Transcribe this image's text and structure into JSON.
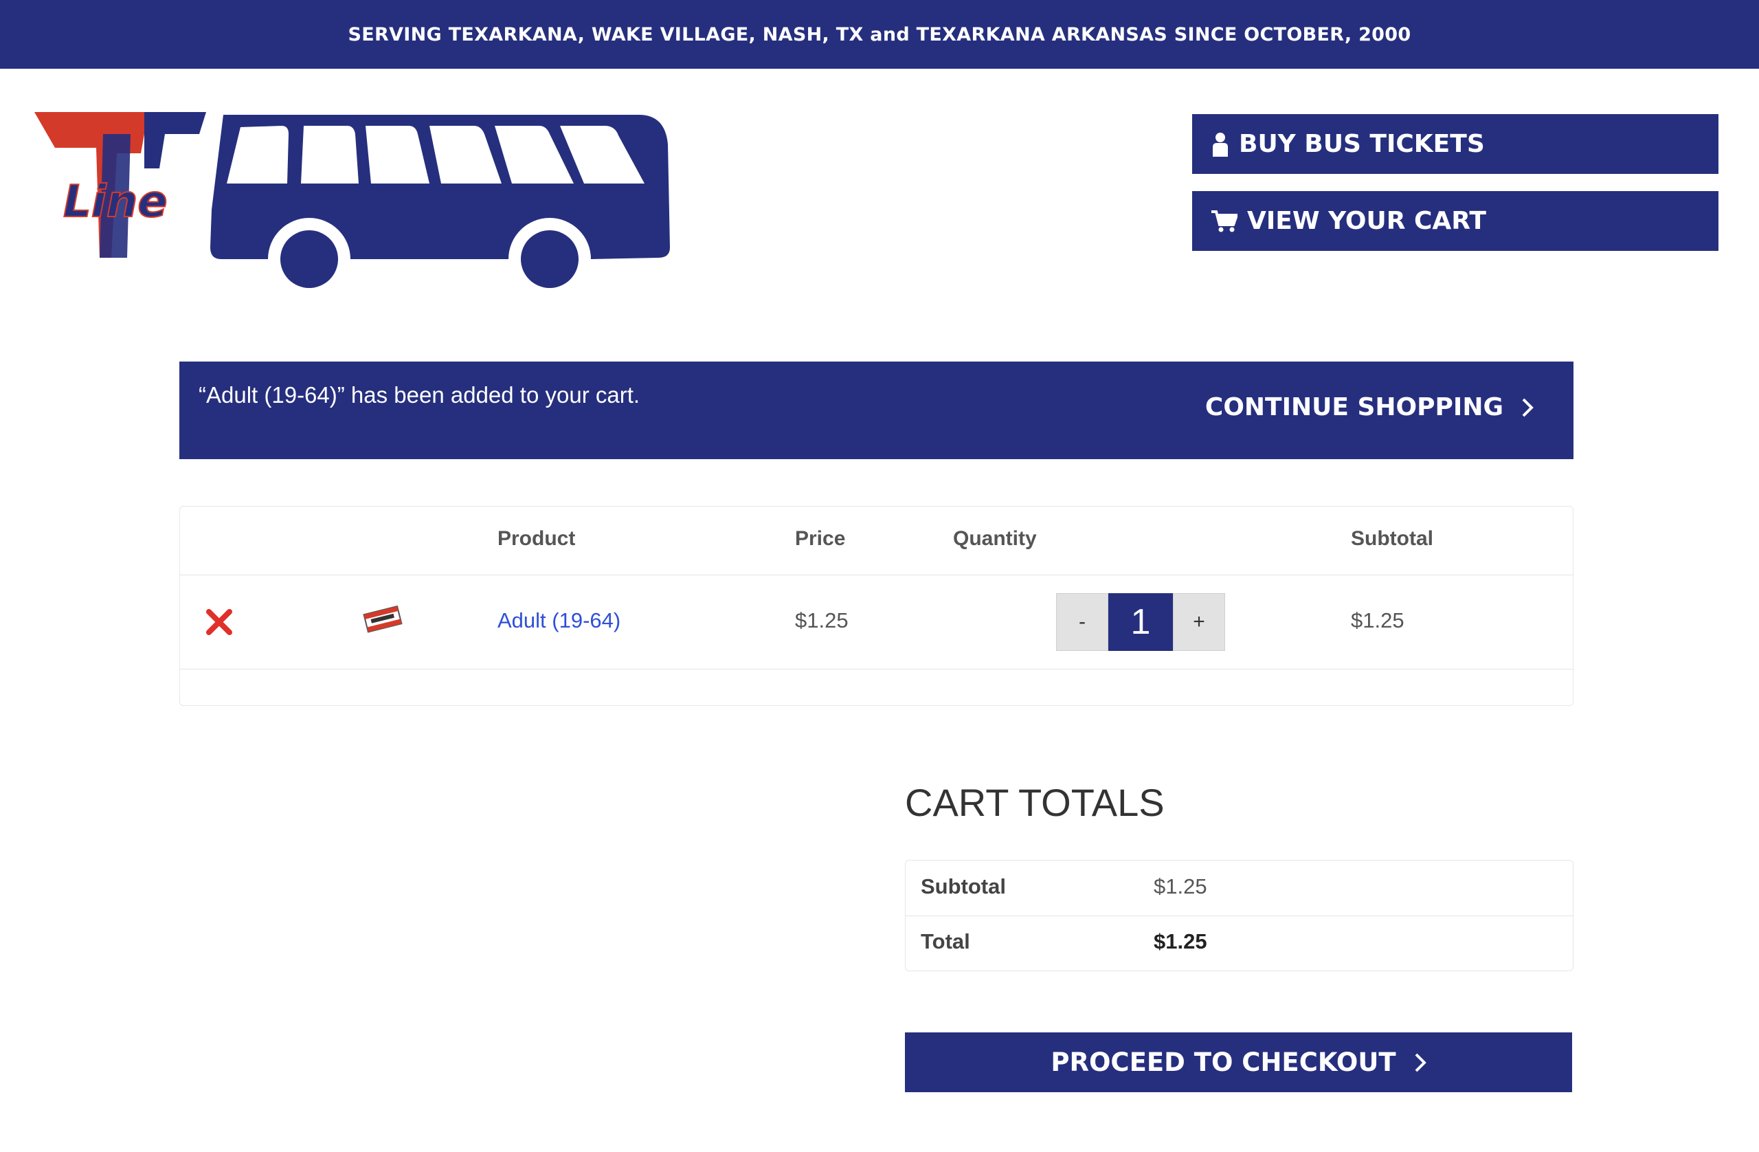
{
  "banner": {
    "text": "SERVING TEXARKANA, WAKE VILLAGE, NASH, TX and TEXARKANA ARKANSAS SINCE OCTOBER, 2000"
  },
  "logo": {
    "wordmark": "Line"
  },
  "header": {
    "buy_tickets_label": "BUY BUS TICKETS",
    "view_cart_label": "VIEW YOUR CART"
  },
  "notice": {
    "message": "“Adult (19-64)” has been added to your cart.",
    "continue_label": "CONTINUE SHOPPING"
  },
  "cart": {
    "columns": {
      "product": "Product",
      "price": "Price",
      "quantity": "Quantity",
      "subtotal": "Subtotal"
    },
    "items": [
      {
        "product": "Adult (19-64)",
        "price": "$1.25",
        "quantity": "1",
        "subtotal": "$1.25",
        "minus": "-",
        "plus": "+"
      }
    ]
  },
  "totals": {
    "title": "CART TOTALS",
    "subtotal_label": "Subtotal",
    "subtotal_value": "$1.25",
    "total_label": "Total",
    "total_value": "$1.25"
  },
  "checkout": {
    "label": "PROCEED TO CHECKOUT"
  },
  "colors": {
    "brand": "#262f7e",
    "logo_red": "#d43a2a",
    "link": "#2f4fd8",
    "remove": "#e0302a"
  },
  "icons": [
    "person-icon",
    "cart-icon",
    "chevron-right-icon",
    "close-icon",
    "ticket-icon"
  ]
}
